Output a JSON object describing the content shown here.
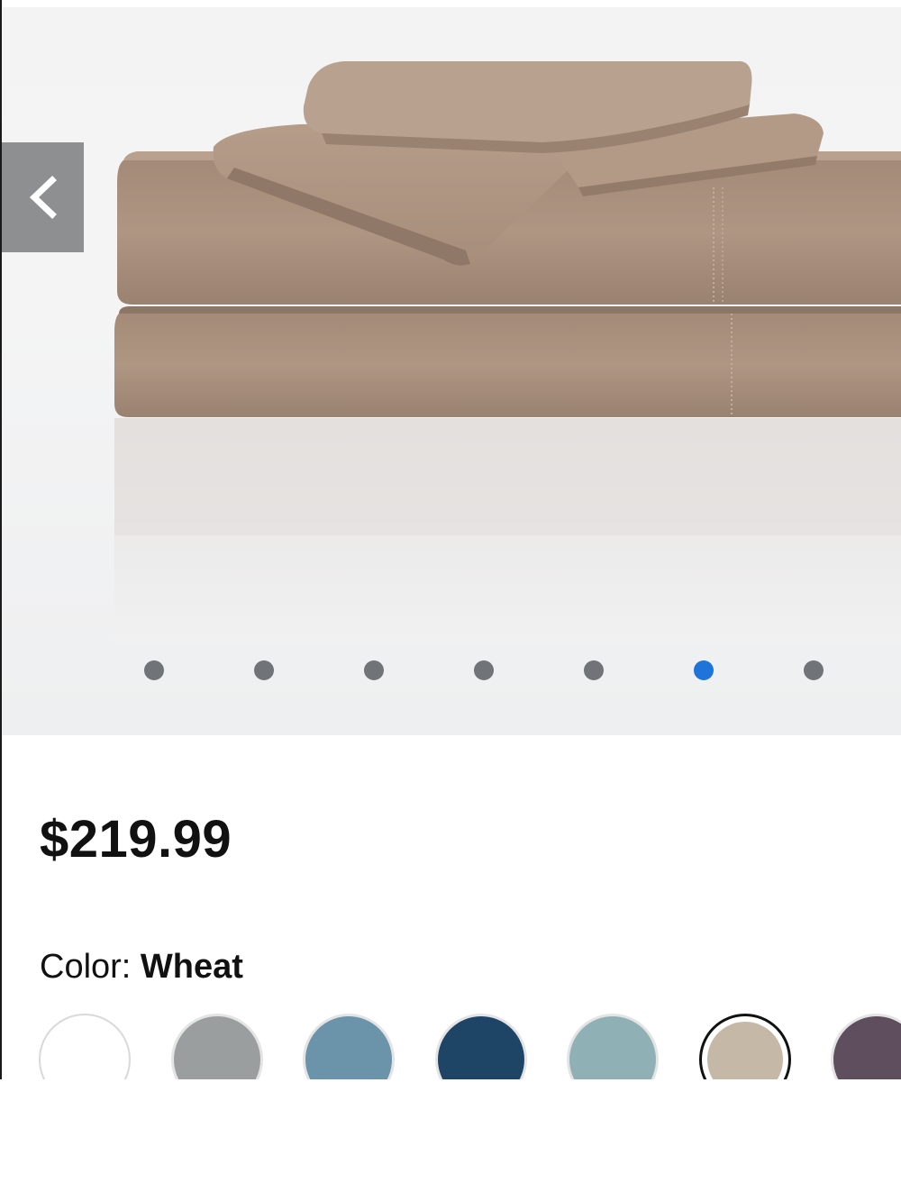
{
  "gallery": {
    "prev_icon": "chevron-left-icon",
    "dot_count": 7,
    "active_dot_index": 5,
    "active_dot_color": "#1e74d8",
    "inactive_dot_color": "#707478"
  },
  "product": {
    "price": "$219.99",
    "color_label": "Color: ",
    "color_value": "Wheat"
  },
  "swatches": [
    {
      "name": "white",
      "color": "#ffffff"
    },
    {
      "name": "gray",
      "color": "#9a9e9f"
    },
    {
      "name": "steel-blue",
      "color": "#6b93a9"
    },
    {
      "name": "navy",
      "color": "#1f4566"
    },
    {
      "name": "seafoam",
      "color": "#8fb1b5"
    },
    {
      "name": "wheat",
      "color": "#c5b8a6",
      "selected": true
    },
    {
      "name": "plum",
      "color": "#5f4f5e"
    }
  ]
}
